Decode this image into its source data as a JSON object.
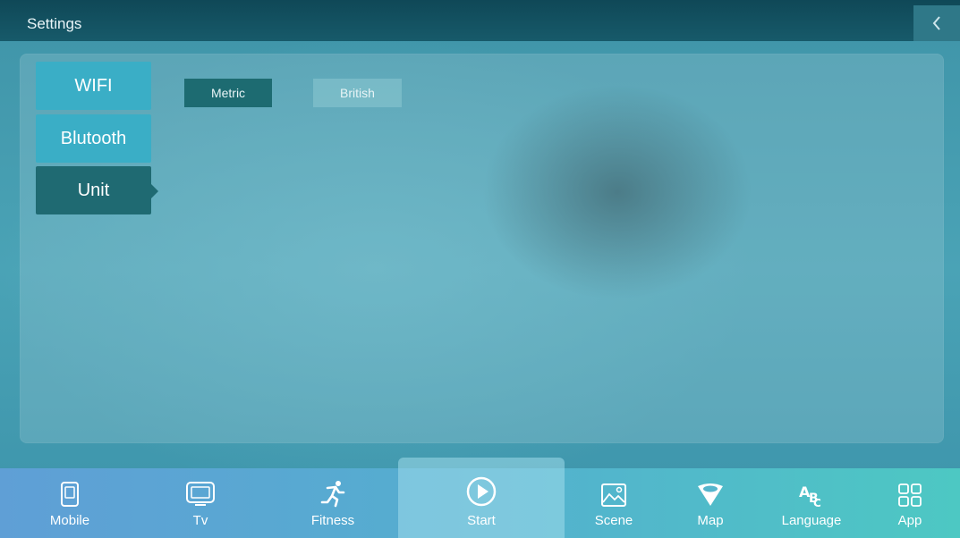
{
  "app": {
    "title": "Settings"
  },
  "menu": {
    "items": [
      {
        "label": "WIFI",
        "selected": false
      },
      {
        "label": "Blutooth",
        "selected": false
      },
      {
        "label": "Unit",
        "selected": true
      }
    ]
  },
  "unit_options": {
    "metric": "Metric",
    "british": "British",
    "selected": "Metric"
  },
  "bottom_nav": {
    "items": [
      {
        "label": "Mobile",
        "icon": "mobile-icon"
      },
      {
        "label": "Tv",
        "icon": "tv-icon"
      },
      {
        "label": "Fitness",
        "icon": "runner-icon"
      },
      {
        "label": "Start",
        "icon": "play-icon"
      },
      {
        "label": "Scene",
        "icon": "image-icon"
      },
      {
        "label": "Map",
        "icon": "map-pin-icon"
      },
      {
        "label": "Language",
        "icon": "language-icon"
      },
      {
        "label": "App",
        "icon": "app-grid-icon"
      }
    ],
    "active": "Start"
  },
  "colors": {
    "titlebar": "#0f4857",
    "menu_item": "#3aaec6",
    "menu_selected": "#1f6a72",
    "option_selected": "#1d6b71"
  }
}
